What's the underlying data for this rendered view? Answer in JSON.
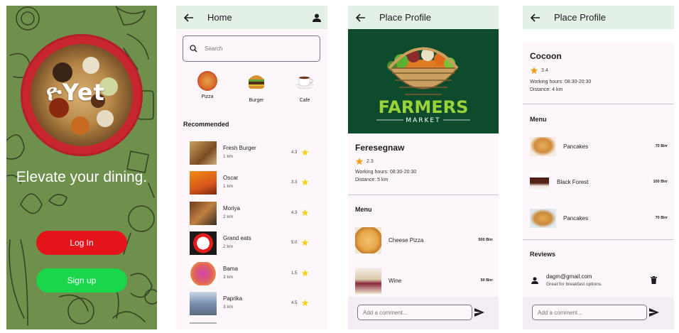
{
  "splash": {
    "logo": "ዮYet",
    "tagline": "Elevate your dining.",
    "login_label": "Log In",
    "signup_label": "Sign up",
    "colors": {
      "background": "#6f8f4d",
      "login": "#e4141b",
      "signup": "#19d64b"
    }
  },
  "home": {
    "title": "Home",
    "search_placeholder": "Search",
    "categories": [
      {
        "label": "Pizza",
        "icon": "pizza-icon"
      },
      {
        "label": "Burger",
        "icon": "burger-icon"
      },
      {
        "label": "Cafe",
        "icon": "coffee-icon"
      }
    ],
    "recommended_title": "Recommended",
    "restaurants": [
      {
        "name": "Fresh Burger",
        "distance": "1 km",
        "rating": "4.3"
      },
      {
        "name": "Oscar",
        "distance": "1 km",
        "rating": "3.3"
      },
      {
        "name": "Moriya",
        "distance": "2 km",
        "rating": "4.3"
      },
      {
        "name": "Grand eats",
        "distance": "2 km",
        "rating": "5.0"
      },
      {
        "name": "Bama",
        "distance": "3 km",
        "rating": "1.5"
      },
      {
        "name": "Paprika",
        "distance": "3 km",
        "rating": "4.5"
      }
    ]
  },
  "profile1": {
    "title": "Place Profile",
    "banner_text": "FARMERS",
    "banner_subtext": "MARKET",
    "name": "Feresegnaw",
    "rating": "2.3",
    "hours": "Working hours: 08:30-20:30",
    "distance": "Distance: 5 km",
    "menu_title": "Menu",
    "menu": [
      {
        "name": "Cheese Pizza",
        "price": "500 Birr"
      },
      {
        "name": "Wine",
        "price": "50 Birr"
      }
    ],
    "comment_placeholder": "Add a comment..."
  },
  "profile2": {
    "title": "Place Profile",
    "name": "Cocoon",
    "rating": "3.4",
    "hours": "Working hours: 08:30-20:30",
    "distance": "Distance: 4 km",
    "menu_title": "Menu",
    "menu": [
      {
        "name": "Pancakes",
        "price": "70 Birr"
      },
      {
        "name": "Black Forest",
        "price": "100 Birr"
      },
      {
        "name": "Pancakes",
        "price": "70 Birr"
      }
    ],
    "reviews_title": "Reviews",
    "review": {
      "user": "dagm@gmail.com",
      "text": "Great for breakfast options."
    },
    "comment_placeholder": "Add a comment..."
  }
}
